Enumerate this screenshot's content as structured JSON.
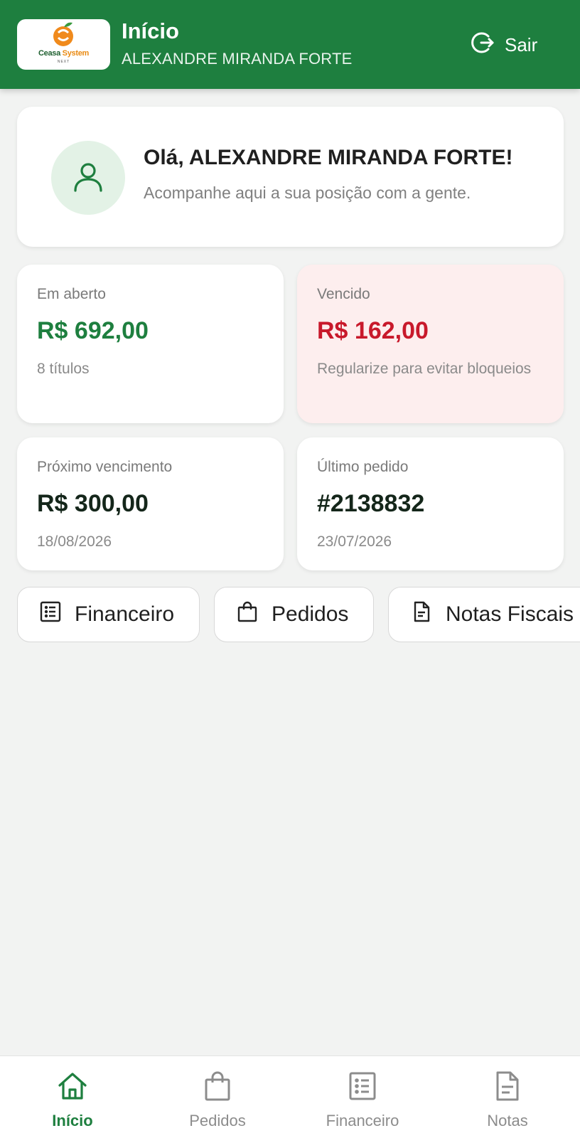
{
  "header": {
    "title": "Início",
    "subtitle": "ALEXANDRE MIRANDA FORTE",
    "logout_label": "Sair",
    "logo": {
      "brand_a": "Ceasa",
      "brand_b": "System",
      "tagline": "NEXT"
    }
  },
  "greeting": {
    "title": "Olá, ALEXANDRE MIRANDA FORTE!",
    "text": "Acompanhe aqui a sua posição com a gente."
  },
  "stats": {
    "open": {
      "label": "Em aberto",
      "value": "R$ 692,00",
      "note": "8 títulos"
    },
    "overdue": {
      "label": "Vencido",
      "value": "R$ 162,00",
      "note": "Regularize para evitar bloqueios"
    },
    "next_due": {
      "label": "Próximo vencimento",
      "value": "R$ 300,00",
      "note": "18/08/2026"
    },
    "last_order": {
      "label": "Último pedido",
      "value": "#2138832",
      "note": "23/07/2026"
    }
  },
  "quick_actions": [
    {
      "label": "Financeiro",
      "icon": "list-icon"
    },
    {
      "label": "Pedidos",
      "icon": "bag-icon"
    },
    {
      "label": "Notas Fiscais",
      "icon": "document-icon"
    }
  ],
  "bottom_nav": [
    {
      "label": "Início",
      "icon": "home-icon",
      "active": true
    },
    {
      "label": "Pedidos",
      "icon": "bag-icon",
      "active": false
    },
    {
      "label": "Financeiro",
      "icon": "list-icon",
      "active": false
    },
    {
      "label": "Notas",
      "icon": "document-icon",
      "active": false
    }
  ],
  "colors": {
    "primary": "#1e7f3f",
    "danger": "#c8192b",
    "danger_bg": "#fdeeee",
    "background": "#f2f3f2"
  }
}
